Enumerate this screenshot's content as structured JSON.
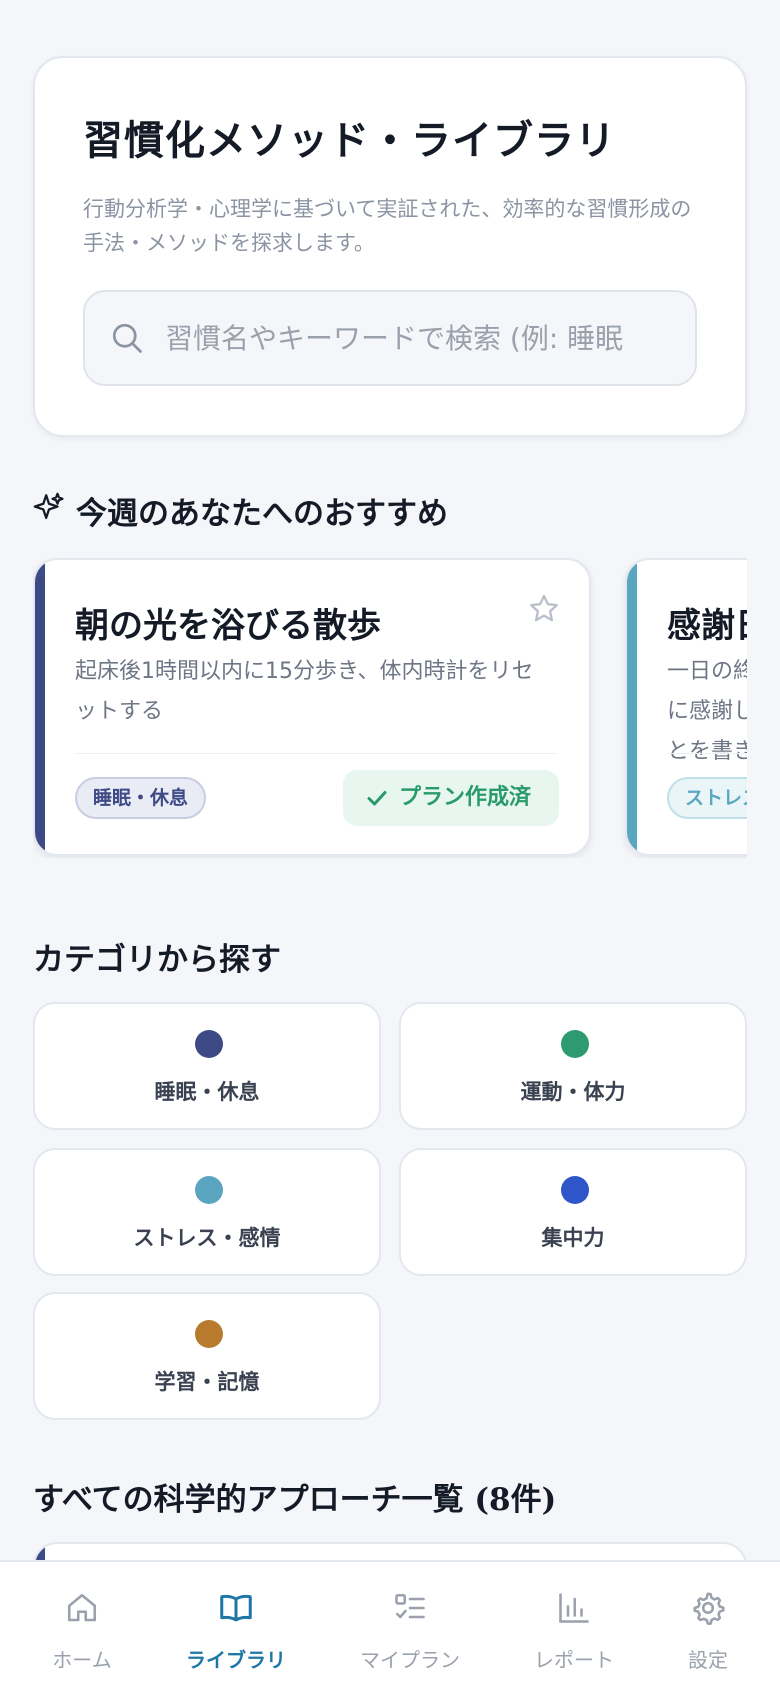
{
  "header": {
    "title": "習慣化メソッド・ライブラリ",
    "description": "行動分析学・心理学に基づいて実証された、効率的な習慣形成の手法・メソッドを探求します。",
    "search_placeholder": "習慣名やキーワードで検索 (例: 睡眠"
  },
  "recommendations": {
    "heading": "今週のあなたへのおすすめ",
    "items": [
      {
        "title": "朝の光を浴びる散歩",
        "description": "起床後1時間以内に15分歩き、体内時計をリセットする",
        "tag": "睡眠・休息",
        "status": "プラン作成済",
        "accent_color": "#3d4a86"
      },
      {
        "title": "感謝日記",
        "description": "一日の終わりに感謝したことを書き出す",
        "tag": "ストレス・感情",
        "accent_color": "#5aa6c0"
      }
    ]
  },
  "categories": {
    "heading": "カテゴリから探す",
    "items": [
      {
        "label": "睡眠・休息",
        "color": "#3d4a86"
      },
      {
        "label": "運動・体力",
        "color": "#2e9a72"
      },
      {
        "label": "ストレス・感情",
        "color": "#5aa6c0"
      },
      {
        "label": "集中力",
        "color": "#2f56c8"
      },
      {
        "label": "学習・記憶",
        "color": "#b87a2c"
      }
    ]
  },
  "all_approaches": {
    "heading": "すべての科学的アプローチ一覧 (8件)"
  },
  "bottom_nav": {
    "items": [
      {
        "label": "ホーム",
        "icon": "home-icon"
      },
      {
        "label": "ライブラリ",
        "icon": "book-icon",
        "active": true
      },
      {
        "label": "マイプラン",
        "icon": "checklist-icon"
      },
      {
        "label": "レポート",
        "icon": "bar-chart-icon"
      },
      {
        "label": "設定",
        "icon": "gear-icon"
      }
    ]
  }
}
